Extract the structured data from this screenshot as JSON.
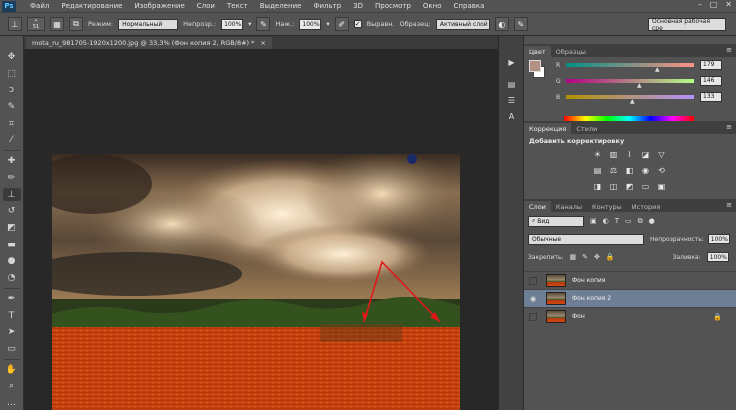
{
  "app": {
    "logo": "Ps",
    "menu": [
      "Файл",
      "Редактирование",
      "Изображение",
      "Слои",
      "Текст",
      "Выделение",
      "Фильтр",
      "3D",
      "Просмотр",
      "Окно",
      "Справка"
    ],
    "window_buttons": [
      "–",
      "□",
      "✕"
    ]
  },
  "options": {
    "brush_size": "51",
    "mode_label": "Режим:",
    "mode_value": "Нормальный",
    "opacity_label": "Непрозр.:",
    "opacity_value": "100%",
    "pressure_label": "Наж.:",
    "pressure_value": "100%",
    "align_label": "Выравн.",
    "sample_label": "Образец:",
    "sample_value": "Активный слой",
    "workspace": "Основная рабочая сре"
  },
  "document": {
    "tab_title": "mota_ru_981705-1920x1200.jpg @ 33,3% (Фон копия 2, RGB/8#) *",
    "close": "×"
  },
  "color_panel": {
    "tabs": [
      "Цвет",
      "Образцы"
    ],
    "rows": [
      {
        "label": "R",
        "value": "179"
      },
      {
        "label": "G",
        "value": "146"
      },
      {
        "label": "B",
        "value": "133"
      }
    ],
    "foreground": "#b39285",
    "background": "#ffffff"
  },
  "adjustments_panel": {
    "tabs": [
      "Коррекция",
      "Стили"
    ],
    "title": "Добавить корректировку"
  },
  "layers_panel": {
    "tabs": [
      "Слои",
      "Каналы",
      "Контуры",
      "История"
    ],
    "kind": "Вид",
    "blend_mode": "Обычные",
    "opacity_label": "Непрозрачность:",
    "opacity_value": "100%",
    "lock_label": "Закрепить:",
    "fill_label": "Заливка:",
    "fill_value": "100%",
    "layers": [
      {
        "name": "Фон копия",
        "visible": false,
        "selected": false
      },
      {
        "name": "Фон копия 2",
        "visible": true,
        "selected": true
      },
      {
        "name": "Фон",
        "visible": false,
        "selected": false,
        "locked": true
      }
    ]
  }
}
